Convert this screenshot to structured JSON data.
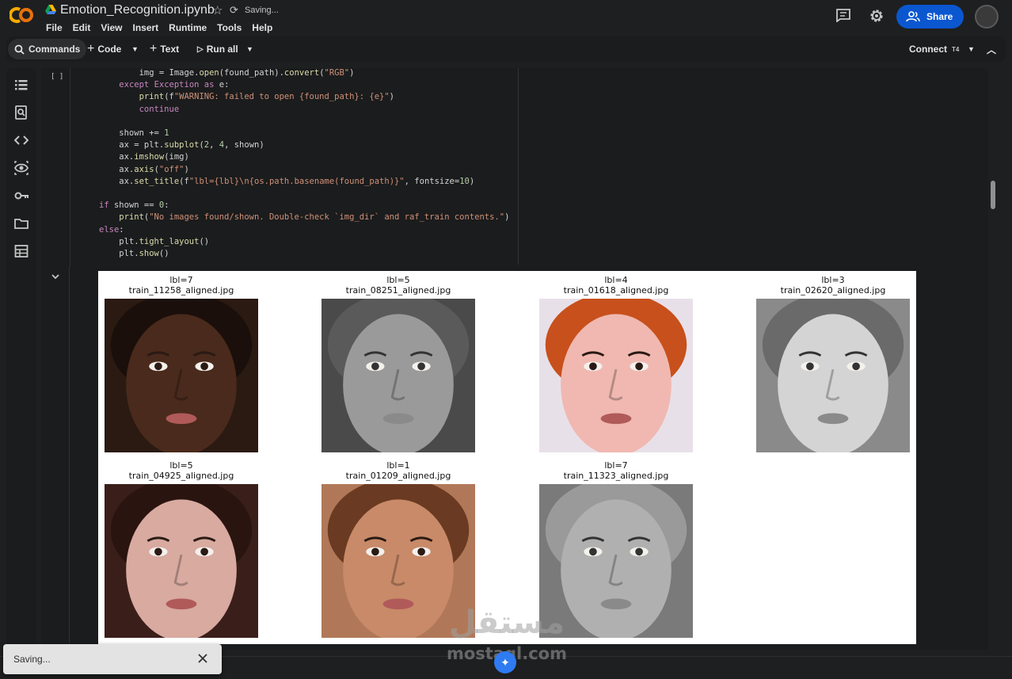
{
  "header": {
    "title": "Emotion_Recognition.ipynb",
    "status": "Saving...",
    "menu": [
      "File",
      "Edit",
      "View",
      "Insert",
      "Runtime",
      "Tools",
      "Help"
    ],
    "share_label": "Share",
    "logo_icon": "colab-logo",
    "colors": {
      "logo": "#f9ab00",
      "share_bg": "#0b57d0"
    }
  },
  "toolbar": {
    "commands_label": "Commands",
    "code_label": "Code",
    "text_label": "Text",
    "run_all_label": "Run all",
    "connect_label": "Connect",
    "connect_tag": "T4"
  },
  "rail_icons": [
    "table-of-contents-icon",
    "find-icon",
    "code-snippets-icon",
    "variable-inspector-icon",
    "secrets-key-icon",
    "files-folder-icon",
    "data-table-icon"
  ],
  "cell": {
    "indicator": "[ ]",
    "code": [
      "        img = Image.open(found_path).convert(\"RGB\")",
      "    except Exception as e:",
      "        print(f\"WARNING: failed to open {found_path}: {e}\")",
      "        continue",
      "",
      "    shown += 1",
      "    ax = plt.subplot(2, 4, shown)",
      "    ax.imshow(img)",
      "    ax.axis(\"off\")",
      "    ax.set_title(f\"lbl={lbl}\\n{os.path.basename(found_path)}\", fontsize=10)",
      "",
      "if shown == 0:",
      "    print(\"No images found/shown. Double-check `img_dir` and raf_train contents.\")",
      "else:",
      "    plt.tight_layout()",
      "    plt.show()"
    ]
  },
  "figure": {
    "subplots": [
      {
        "label": "lbl=7",
        "file": "train_11258_aligned.jpg",
        "skin": "#4a2a1c",
        "bg": "#2a1a12",
        "hair": "#1a0f0a",
        "gray": false
      },
      {
        "label": "lbl=5",
        "file": "train_08251_aligned.jpg",
        "skin": "#9a9a9a",
        "bg": "#4a4a4a",
        "hair": "#5a5a5a",
        "gray": true
      },
      {
        "label": "lbl=4",
        "file": "train_01618_aligned.jpg",
        "skin": "#f0b8b0",
        "bg": "#e8e0e8",
        "hair": "#c8501c",
        "gray": false
      },
      {
        "label": "lbl=3",
        "file": "train_02620_aligned.jpg",
        "skin": "#d4d4d4",
        "bg": "#8a8a8a",
        "hair": "#6a6a6a",
        "gray": true
      },
      {
        "label": "lbl=5",
        "file": "train_04925_aligned.jpg",
        "skin": "#d8aaa0",
        "bg": "#3a1e1a",
        "hair": "#2a1410",
        "gray": false
      },
      {
        "label": "lbl=1",
        "file": "train_01209_aligned.jpg",
        "skin": "#c88a68",
        "bg": "#b07858",
        "hair": "#6a3a22",
        "gray": false
      },
      {
        "label": "lbl=7",
        "file": "train_11323_aligned.jpg",
        "skin": "#b0b0b0",
        "bg": "#7a7a7a",
        "hair": "#9a9a9a",
        "gray": true
      }
    ]
  },
  "toast": {
    "text": "Saving..."
  },
  "watermark": {
    "arabic": "مستقل",
    "latin": "mostaql.com"
  }
}
